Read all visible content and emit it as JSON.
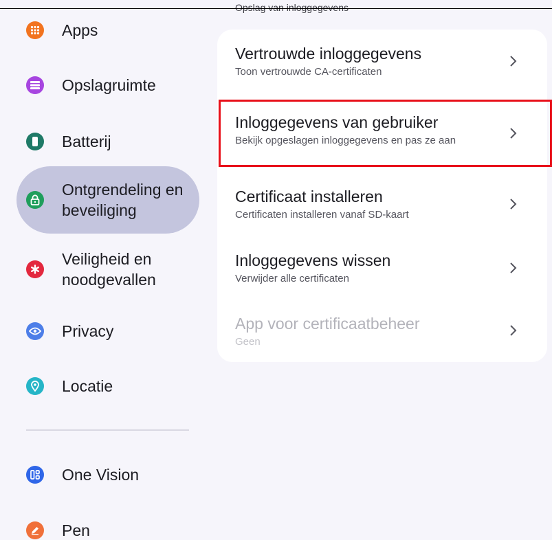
{
  "sidebar": {
    "items": [
      {
        "label": "Apps",
        "icon": "apps-grid-icon",
        "color": "#f2731f"
      },
      {
        "label": "Opslagruimte",
        "icon": "storage-icon",
        "color": "#a745e0"
      },
      {
        "label": "Batterij",
        "icon": "battery-icon",
        "color": "#1f7a67"
      },
      {
        "label": "Ontgrendeling en\nbeveiliging",
        "icon": "lock-icon",
        "color": "#1f9e5c",
        "active": true
      },
      {
        "label": "Veiligheid en\nnoodgevallen",
        "icon": "emergency-icon",
        "color": "#e3283e"
      },
      {
        "label": "Privacy",
        "icon": "privacy-eye-icon",
        "color": "#4d7ee8"
      },
      {
        "label": "Locatie",
        "icon": "location-pin-icon",
        "color": "#25b5c7"
      },
      {
        "label": "One Vision",
        "icon": "one-vision-icon",
        "color": "#2f66e8"
      },
      {
        "label": "Pen",
        "icon": "pen-icon",
        "color": "#f0703a"
      }
    ]
  },
  "main": {
    "section_header": "Opslag van inloggegevens",
    "rows": [
      {
        "title": "Vertrouwde inloggegevens",
        "subtitle": "Toon vertrouwde CA-certificaten",
        "enabled": true
      },
      {
        "title": "Inloggegevens van gebruiker",
        "subtitle": "Bekijk opgeslagen inloggegevens en pas ze aan",
        "enabled": true,
        "highlighted": true
      },
      {
        "title": "Certificaat installeren",
        "subtitle": "Certificaten installeren vanaf SD-kaart",
        "enabled": true
      },
      {
        "title": "Inloggegevens wissen",
        "subtitle": "Verwijder alle certificaten",
        "enabled": true
      },
      {
        "title": "App voor certificaatbeheer",
        "subtitle": "Geen",
        "enabled": false
      }
    ]
  },
  "colors": {
    "background": "#f6f5fb",
    "card": "#ffffff",
    "active_pill": "#c4c5de",
    "highlight_border": "#e8101a",
    "chevron": "#55555e"
  }
}
